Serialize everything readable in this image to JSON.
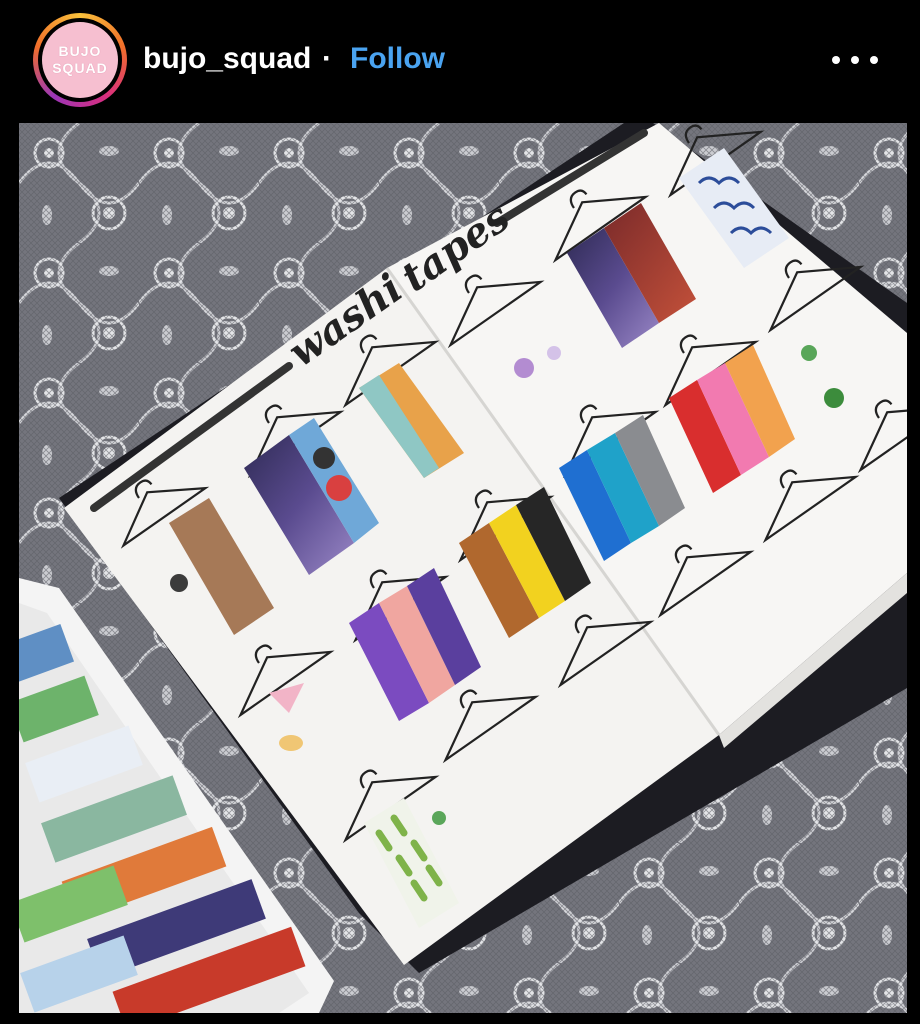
{
  "post": {
    "username": "bujo_squad",
    "separator": "·",
    "follow_label": "Follow",
    "avatar": {
      "line1": "BUJO",
      "line2": "SQUAD"
    },
    "more_icon": "more-horizontal-icon"
  },
  "photo": {
    "heading_word1": "washi",
    "heading_word2": "tapes"
  },
  "colors": {
    "follow_blue": "#4aa3f0",
    "avatar_pink": "#f6bfd0"
  }
}
